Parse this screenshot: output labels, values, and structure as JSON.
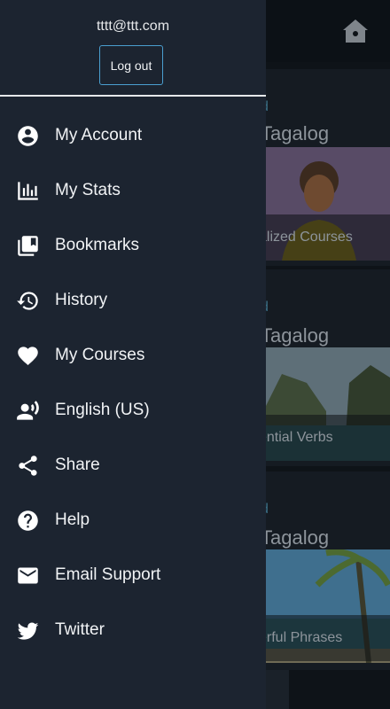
{
  "drawer": {
    "user_email": "tttt@ttt.com",
    "logout_label": "Log out",
    "items": [
      {
        "label": "My Account",
        "icon": "account-circle-icon"
      },
      {
        "label": "My Stats",
        "icon": "stats-bars-icon"
      },
      {
        "label": "Bookmarks",
        "icon": "bookmarks-icon"
      },
      {
        "label": "History",
        "icon": "history-icon"
      },
      {
        "label": "My Courses",
        "icon": "heart-icon"
      },
      {
        "label": "English (US)",
        "icon": "speaker-voice-icon"
      },
      {
        "label": "Share",
        "icon": "share-icon"
      },
      {
        "label": "Help",
        "icon": "help-circle-icon"
      },
      {
        "label": "Email Support",
        "icon": "mail-icon"
      },
      {
        "label": "Twitter",
        "icon": "twitter-icon"
      }
    ]
  },
  "background": {
    "home_icon": "home-icon",
    "cards": [
      {
        "kicker": "d",
        "title": "Tagalog",
        "caption": "alized Courses"
      },
      {
        "kicker": "d",
        "title": "Tagalog",
        "caption": "ential Verbs"
      },
      {
        "kicker": "d",
        "title": "Tagalog",
        "caption": "erful Phrases"
      }
    ]
  },
  "colors": {
    "drawer_bg": "#1c2430",
    "accent": "#4a9fd0",
    "text": "#f1f3f5"
  }
}
